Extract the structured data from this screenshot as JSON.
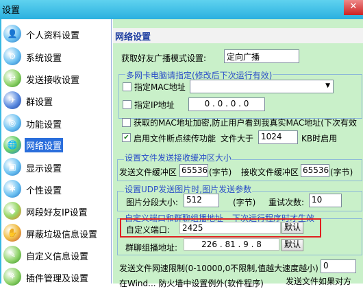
{
  "window": {
    "title": "设置",
    "close_label": "✕"
  },
  "sidebar": {
    "items": [
      {
        "label": "个人资料设置",
        "icon": "profile-icon"
      },
      {
        "label": "系统设置",
        "icon": "system-icon"
      },
      {
        "label": "发送接收设置",
        "icon": "send-receive-icon"
      },
      {
        "label": "群设置",
        "icon": "group-icon"
      },
      {
        "label": "功能设置",
        "icon": "function-icon"
      },
      {
        "label": "网络设置",
        "icon": "network-icon",
        "selected": true
      },
      {
        "label": "显示设置",
        "icon": "display-icon"
      },
      {
        "label": "个性设置",
        "icon": "personal-icon"
      },
      {
        "label": "网段好友IP设置",
        "icon": "ip-icon"
      },
      {
        "label": "屏蔽垃圾信息设置",
        "icon": "block-spam-icon"
      },
      {
        "label": "自定义信息设置",
        "icon": "custom-info-icon"
      },
      {
        "label": "插件管理及设置",
        "icon": "plugin-icon"
      }
    ]
  },
  "main": {
    "header": "网络设置",
    "broadcast": {
      "label": "获取好友广播模式设置:",
      "value": "定向广播"
    },
    "nic_group": {
      "title": "多网卡电脑请指定(修改后下次运行有效)",
      "mac_label": "指定MAC地址",
      "mac_value": "",
      "ip_label": "指定IP地址",
      "ip_value": "0 . 0 . 0 . 0"
    },
    "mac_encrypt": {
      "label": "获取的MAC地址加密,防止用户看到我真实MAC地址(下次有效"
    },
    "resume": {
      "label": "启用文件断点续传功能",
      "size_label": "文件大于",
      "size_value": "1024",
      "unit": "KB时启用"
    },
    "buffer_group": {
      "title": "设置文件发送接收缓冲区大小",
      "send_label": "发送文件缓冲区",
      "send_value": "65536",
      "send_unit": "(字节)",
      "recv_label": "接收文件缓冲区",
      "recv_value": "65536",
      "recv_unit": "(字节)"
    },
    "udp_group": {
      "title": "设置UDP发送图片时,图片发送参数",
      "chunk_label": "图片分段大小:",
      "chunk_value": "512",
      "chunk_unit": "(字节)",
      "retry_label": "重试次数:",
      "retry_value": "10"
    },
    "port_group": {
      "title": "自定义端口和群聊组播地址---下次运行程序时才生效",
      "port_label": "自定义端口:",
      "port_value": "2425",
      "port_default": "默认",
      "mcast_label": "群聊组播地址:",
      "mcast_value": "226 . 81 . 9 . 8",
      "mcast_default": "默认"
    },
    "speed_limit": {
      "label": "发送文件网速限制(0-10000,0不限制,值越大速度越小)",
      "value": "0"
    },
    "bottom_partial": "在Wind... 防火墙中设置例外(软件程序)",
    "bottom_right": "发送文件如果对方"
  }
}
